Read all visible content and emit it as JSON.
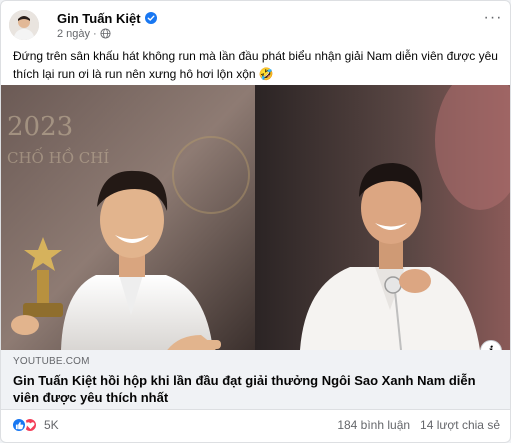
{
  "post": {
    "author": "Gin Tuấn Kiệt",
    "time": "2 ngày",
    "visibility_icon": "globe-icon",
    "verified_icon": "verified-badge-icon",
    "text": "Đứng trên sân khấu hát không run mà lần đầu phát biểu nhận giải Nam diễn viên được yêu thích lại run ơi là run nên xưng hô hơi lộn xộn",
    "emoji": "🤣"
  },
  "link": {
    "domain": "YOUTUBE.COM",
    "title": "Gin Tuấn Kiệt hồi hộp khi lần đầu đạt giải thưởng Ngôi Sao Xanh Nam diễn viên được yêu thích nhất"
  },
  "photos": {
    "left_backdrop_text_1": "2023",
    "left_backdrop_text_2": "CHỐ HỒ CHÍ"
  },
  "engagement": {
    "reaction_count": "5K",
    "comments": "184 bình luận",
    "shares": "14 lượt chia sẻ"
  },
  "colors": {
    "facebook_blue": "#1877f2",
    "love_red": "#f33e58",
    "secondary_text": "#65676b"
  }
}
